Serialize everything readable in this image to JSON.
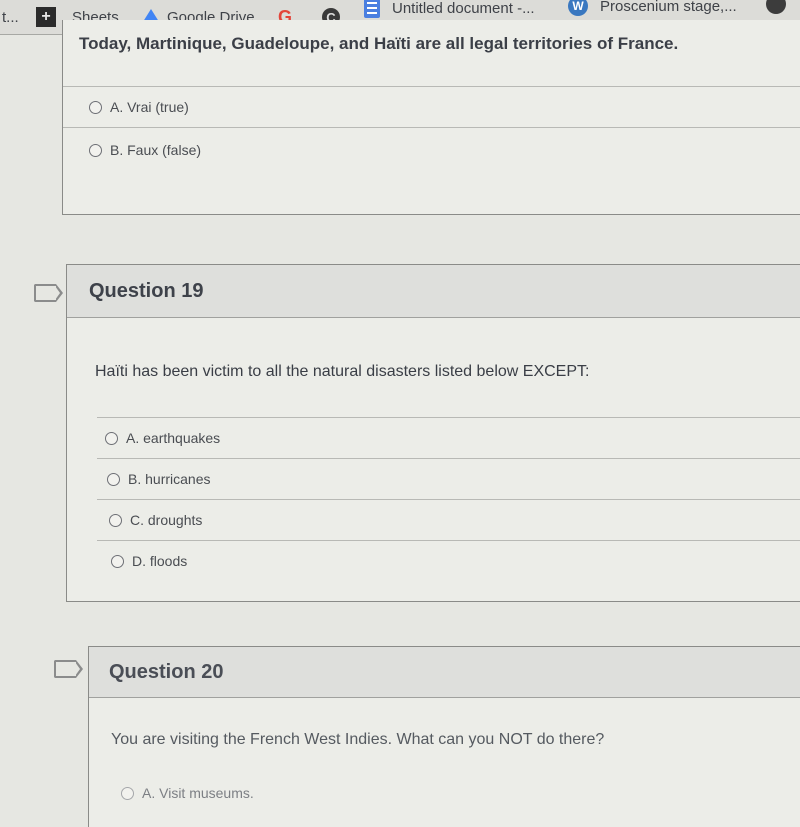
{
  "bookmarks_bar": {
    "items": [
      {
        "label": "t...",
        "icon": "truncated-item"
      },
      {
        "label": "Sheets",
        "icon": "sheets-icon"
      },
      {
        "label": "Google Drive",
        "icon": "google-drive-icon"
      },
      {
        "label": "",
        "icon": "google-icon",
        "glyph": "G"
      },
      {
        "label": "",
        "icon": "c-icon",
        "glyph": "C"
      },
      {
        "label": "Untitled document -...",
        "icon": "google-docs-icon"
      },
      {
        "label": "Proscenium stage,...",
        "icon": "wordpress-icon",
        "glyph": "W"
      },
      {
        "label": "",
        "icon": "profile-icon"
      }
    ],
    "plus_glyph": "+"
  },
  "questions": [
    {
      "title": "",
      "text": "Today, Martinique, Guadeloupe, and Haïti are all legal territories of France.",
      "answers": [
        "A. Vrai (true)",
        "B. Faux (false)"
      ]
    },
    {
      "title": "Question 19",
      "text": "Haïti has been victim to all the natural disasters listed below EXCEPT:",
      "answers": [
        "A. earthquakes",
        "B. hurricanes",
        "C. droughts",
        "D. floods"
      ]
    },
    {
      "title": "Question 20",
      "text": "You are visiting the French West Indies. What can you NOT do there?",
      "answers": [
        "A. Visit museums."
      ]
    }
  ]
}
